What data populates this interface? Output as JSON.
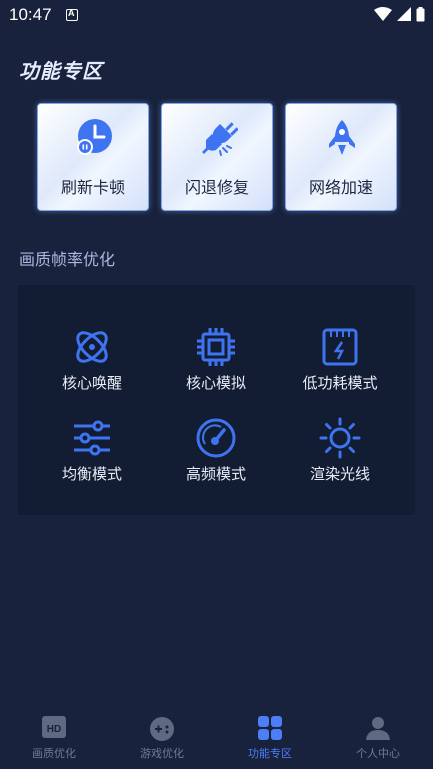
{
  "status_bar": {
    "time": "10:47",
    "notification": "A"
  },
  "header": {
    "title": "功能专区"
  },
  "quick_cards": [
    {
      "label": "刷新卡顿",
      "icon": "clock-refresh-icon"
    },
    {
      "label": "闪退修复",
      "icon": "plug-disconnect-icon"
    },
    {
      "label": "网络加速",
      "icon": "rocket-icon"
    }
  ],
  "section": {
    "title": "画质帧率优化"
  },
  "features": [
    {
      "label": "核心唤醒",
      "icon": "atom-icon"
    },
    {
      "label": "核心模拟",
      "icon": "cpu-chip-icon"
    },
    {
      "label": "低功耗模式",
      "icon": "power-save-icon"
    },
    {
      "label": "均衡模式",
      "icon": "sliders-icon"
    },
    {
      "label": "高频模式",
      "icon": "speedometer-icon"
    },
    {
      "label": "渲染光线",
      "icon": "sun-icon"
    }
  ],
  "tabbar": {
    "tabs": [
      {
        "label": "画质优化",
        "icon": "hd-icon",
        "active": false
      },
      {
        "label": "游戏优化",
        "icon": "gamepad-icon",
        "active": false
      },
      {
        "label": "功能专区",
        "icon": "grid-icon",
        "active": true
      },
      {
        "label": "个人中心",
        "icon": "person-icon",
        "active": false
      }
    ]
  },
  "colors": {
    "background": "#18223c",
    "accent": "#4d7ef7",
    "panel": "#121d33",
    "inactive": "#6f7a93"
  }
}
